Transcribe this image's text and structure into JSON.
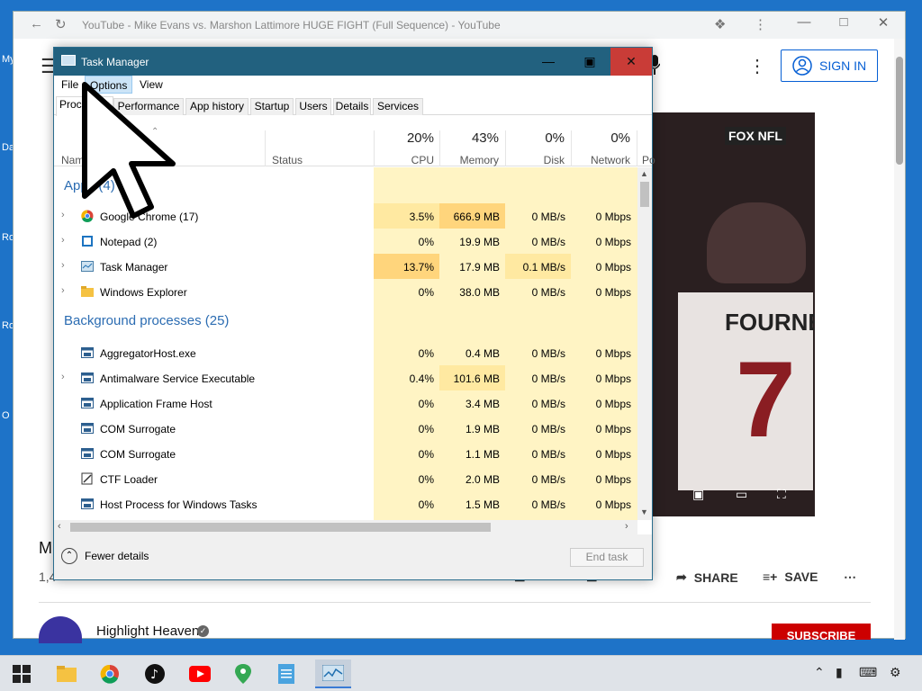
{
  "desktop": {
    "icon_labels": [
      "My",
      "Da",
      "Ro",
      "Ro",
      "O"
    ]
  },
  "browser": {
    "tab_title": "YouTube - Mike Evans vs. Marshon Lattimore HUGE FIGHT (Full Sequence) - YouTube",
    "sign_in_label": "SIGN IN",
    "video_overlay_logo": "FOX NFL",
    "video_player_text": "FOURNE",
    "video_number": "7",
    "video_title_fragment": "M",
    "video_views_fragment": "1,4",
    "actions": {
      "like_label": "",
      "dislike_label": "",
      "share_label": "SHARE",
      "save_label": "SAVE"
    },
    "channel_name": "Highlight Heaven",
    "subscribe_label": "SUBSCRIBE"
  },
  "task_manager": {
    "title": "Task Manager",
    "menu": [
      "File",
      "Options",
      "View"
    ],
    "active_menu": "Options",
    "tabs": [
      "Processes",
      "Performance",
      "App history",
      "Startup",
      "Users",
      "Details",
      "Services"
    ],
    "active_tab": "Processes",
    "columns": {
      "name": "Name",
      "status": "Status",
      "cpu": {
        "percent": "20%",
        "label": "CPU"
      },
      "memory": {
        "percent": "43%",
        "label": "Memory"
      },
      "disk": {
        "percent": "0%",
        "label": "Disk"
      },
      "network": {
        "percent": "0%",
        "label": "Network"
      },
      "power_fragment": "Po"
    },
    "apps_group": "Apps (4)",
    "apps": [
      {
        "name": "Google Chrome (17)",
        "icon": "chrome-icon",
        "cpu": "3.5%",
        "memory": "666.9 MB",
        "disk": "0 MB/s",
        "network": "0 Mbps",
        "expandable": true
      },
      {
        "name": "Notepad (2)",
        "icon": "notepad-icon",
        "cpu": "0%",
        "memory": "19.9 MB",
        "disk": "0 MB/s",
        "network": "0 Mbps",
        "expandable": true
      },
      {
        "name": "Task Manager",
        "icon": "task-manager-icon",
        "cpu": "13.7%",
        "memory": "17.9 MB",
        "disk": "0.1 MB/s",
        "network": "0 Mbps",
        "expandable": true
      },
      {
        "name": "Windows Explorer",
        "icon": "folder-icon",
        "cpu": "0%",
        "memory": "38.0 MB",
        "disk": "0 MB/s",
        "network": "0 Mbps",
        "expandable": true
      }
    ],
    "background_group": "Background processes (25)",
    "background": [
      {
        "name": "AggregatorHost.exe",
        "icon": "process-icon",
        "cpu": "0%",
        "memory": "0.4 MB",
        "disk": "0 MB/s",
        "network": "0 Mbps",
        "expandable": false
      },
      {
        "name": "Antimalware Service Executable",
        "icon": "process-icon",
        "cpu": "0.4%",
        "memory": "101.6 MB",
        "disk": "0 MB/s",
        "network": "0 Mbps",
        "expandable": true
      },
      {
        "name": "Application Frame Host",
        "icon": "process-icon",
        "cpu": "0%",
        "memory": "3.4 MB",
        "disk": "0 MB/s",
        "network": "0 Mbps",
        "expandable": false
      },
      {
        "name": "COM Surrogate",
        "icon": "process-icon",
        "cpu": "0%",
        "memory": "1.9 MB",
        "disk": "0 MB/s",
        "network": "0 Mbps",
        "expandable": false
      },
      {
        "name": "COM Surrogate",
        "icon": "process-icon",
        "cpu": "0%",
        "memory": "1.1 MB",
        "disk": "0 MB/s",
        "network": "0 Mbps",
        "expandable": false
      },
      {
        "name": "CTF Loader",
        "icon": "ctf-icon",
        "cpu": "0%",
        "memory": "2.0 MB",
        "disk": "0 MB/s",
        "network": "0 Mbps",
        "expandable": false
      },
      {
        "name": "Host Process for Windows Tasks",
        "icon": "process-icon",
        "cpu": "0%",
        "memory": "1.5 MB",
        "disk": "0 MB/s",
        "network": "0 Mbps",
        "expandable": false
      }
    ],
    "fewer_details": "Fewer details",
    "end_task": "End task"
  },
  "taskbar": {
    "items": [
      "start-icon",
      "file-explorer-icon",
      "chrome-icon",
      "tiktok-icon",
      "youtube-icon",
      "maps-icon",
      "notepad-icon",
      "task-manager-icon"
    ],
    "active": "task-manager-icon"
  },
  "colors": {
    "tm_titlebar": "#22617f",
    "tm_close": "#c93c37",
    "heat_light": "#fff4c4",
    "heat_mid": "#ffe9a1",
    "heat_strong": "#ffd57c",
    "group_blue": "#2b6cb2",
    "yt_red": "#cc0000",
    "signin_blue": "#065fd4"
  }
}
